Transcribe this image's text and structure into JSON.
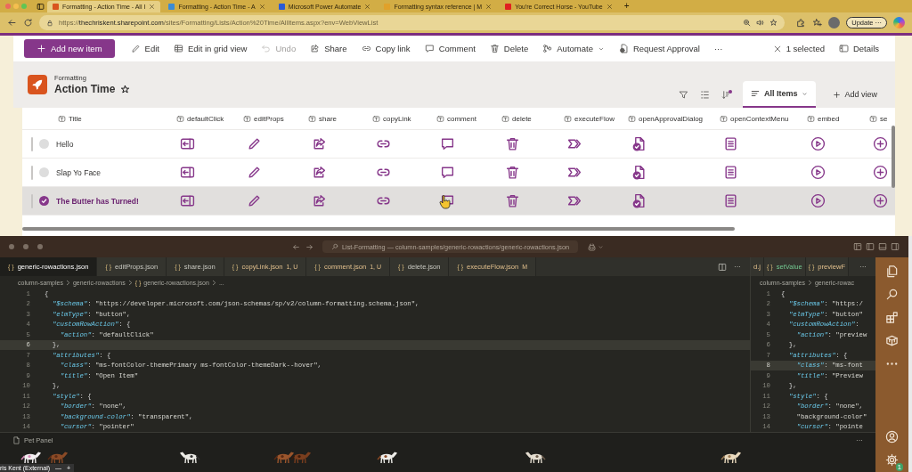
{
  "browser": {
    "tabs": [
      {
        "title": "Formatting - Action Time - All I",
        "selected": true
      },
      {
        "title": "Formatting - Action Time - A",
        "selected": false
      },
      {
        "title": "Microsoft Power Automate",
        "selected": false
      },
      {
        "title": "Formatting syntax reference | M",
        "selected": false
      },
      {
        "title": "You're Correct Horse - YouTube",
        "selected": false
      }
    ],
    "new_tab": "+",
    "url": "https://**thechriskent.sharepoint.com**/sites/Formatting/Lists/Action%20Time/AllItems.aspx?env=WebViewList",
    "update_button": "Update",
    "update_more": "···"
  },
  "list_app": {
    "toolbar": [
      {
        "label": "Add new item",
        "kind": "primary",
        "disabled": false
      },
      {
        "label": "Edit",
        "kind": "action",
        "disabled": false
      },
      {
        "label": "Edit in grid view",
        "kind": "action",
        "disabled": false
      },
      {
        "label": "Undo",
        "kind": "action",
        "disabled": true
      },
      {
        "label": "Share",
        "kind": "action",
        "disabled": false
      },
      {
        "label": "Copy link",
        "kind": "action",
        "disabled": false
      },
      {
        "label": "Comment",
        "kind": "action",
        "disabled": false
      },
      {
        "label": "Delete",
        "kind": "action",
        "disabled": false
      },
      {
        "label": "Automate",
        "kind": "menu",
        "disabled": false
      },
      {
        "label": "Request Approval",
        "kind": "action",
        "disabled": false
      },
      {
        "label": "···",
        "kind": "more",
        "disabled": false
      }
    ],
    "selection": "1 selected",
    "details": "Details",
    "site": "Formatting",
    "list_title": "Action Time",
    "views": [
      {
        "label": "All Items",
        "selected": true
      }
    ],
    "add_view": "Add view",
    "columns": [
      "Title",
      "defaultClick",
      "editProps",
      "share",
      "copyLink",
      "comment",
      "delete",
      "executeFlow",
      "openApprovalDialog",
      "openContextMenu",
      "embed",
      "se"
    ],
    "rows": [
      {
        "title": "Hello",
        "selected": false
      },
      {
        "title": "Slap Yo Face",
        "selected": false
      },
      {
        "title": "The Butter has Turned!",
        "selected": true
      }
    ]
  },
  "editor": {
    "title": "List-Formatting — column-samples/generic-rowactions/generic-rowactions.json",
    "tabs": [
      {
        "icon": "{ }",
        "label": "generic-rowactions.json",
        "modified": false,
        "selected": true
      },
      {
        "icon": "{ }",
        "label": "editProps.json",
        "modified": false,
        "selected": false
      },
      {
        "icon": "{ }",
        "label": "share.json",
        "modified": false,
        "selected": false
      },
      {
        "icon": "{ }",
        "label": "copyLink.json",
        "badge": "1, U",
        "modified": true,
        "selected": false
      },
      {
        "icon": "{ }",
        "label": "comment.json",
        "badge": "1, U",
        "modified": true,
        "selected": false
      },
      {
        "icon": "{ }",
        "label": "delete.json",
        "modified": false,
        "selected": false
      },
      {
        "icon": "{ }",
        "label": "executeFlow.json",
        "badge": "M",
        "modified": true,
        "selected": false
      }
    ],
    "tabs_more": "···",
    "breadcrumbs": [
      "column-samples",
      "generic-rowactions",
      "generic-rowactions.json",
      "..."
    ],
    "breadcrumb_icon": "{ }",
    "lines": [
      {
        "number": "1",
        "text": "{",
        "current": false
      },
      {
        "number": "2",
        "text": "  \"$schema\": \"https://developer.microsoft.com/json-schemas/sp/v2/column-formatting.schema.json\",",
        "current": false
      },
      {
        "number": "3",
        "text": "  \"elmType\": \"button\",",
        "current": false
      },
      {
        "number": "4",
        "text": "  \"customRowAction\": {",
        "current": false
      },
      {
        "number": "5",
        "text": "    \"action\": \"defaultClick\"",
        "current": false
      },
      {
        "number": "6",
        "text": "  },",
        "current": true
      },
      {
        "number": "7",
        "text": "  \"attributes\": {",
        "current": false
      },
      {
        "number": "8",
        "text": "    \"class\": \"ms-fontColor-themePrimary ms-fontColor-themeDark--hover\",",
        "current": false
      },
      {
        "number": "9",
        "text": "    \"title\": \"Open Item\"",
        "current": false
      },
      {
        "number": "10",
        "text": "  },",
        "current": false
      },
      {
        "number": "11",
        "text": "  \"style\": {",
        "current": false
      },
      {
        "number": "12",
        "text": "    \"border\": \"none\",",
        "current": false
      },
      {
        "number": "13",
        "text": "    \"background-color\": \"transparent\",",
        "current": false
      },
      {
        "number": "14",
        "text": "    \"cursor\": \"pointer\"",
        "current": false
      }
    ],
    "side_tabs": [
      {
        "label": "d.j",
        "modified": true,
        "added": false
      },
      {
        "icon": "{ }",
        "label": "setValue",
        "modified": false,
        "added": true
      },
      {
        "icon": "{ }",
        "label": "previewF",
        "modified": true,
        "added": false
      }
    ],
    "side_more": "···",
    "side_breadcrumbs": [
      "column-samples",
      "generic-rowac"
    ],
    "side_lines": [
      {
        "number": "1",
        "text": "{",
        "current": false
      },
      {
        "number": "2",
        "text": "  \"$schema\": \"https:/",
        "current": false
      },
      {
        "number": "3",
        "text": "  \"elmType\": \"button\"",
        "current": false
      },
      {
        "number": "4",
        "text": "  \"customRowAction\":",
        "current": false
      },
      {
        "number": "5",
        "text": "    \"action\": \"preview",
        "current": false
      },
      {
        "number": "6",
        "text": "  },",
        "current": false
      },
      {
        "number": "7",
        "text": "  \"attributes\": {",
        "current": false
      },
      {
        "number": "8",
        "text": "    \"class\": \"ms-font",
        "current": true
      },
      {
        "number": "9",
        "text": "    \"title\": \"Preview",
        "current": false
      },
      {
        "number": "10",
        "text": "  },",
        "current": false
      },
      {
        "number": "11",
        "text": "  \"style\": {",
        "current": false
      },
      {
        "number": "12",
        "text": "    \"border\": \"none\",",
        "current": false
      },
      {
        "number": "13",
        "text": "    \"background-color\"",
        "current": false
      },
      {
        "number": "14",
        "text": "    \"cursor\": \"pointe",
        "current": false
      }
    ],
    "panel_title": "Pet Panel",
    "panel_more": "···",
    "settings_badge": "1"
  },
  "call_bar": {
    "name": "ris Kent (External)",
    "minimize": "—",
    "add": "+"
  }
}
